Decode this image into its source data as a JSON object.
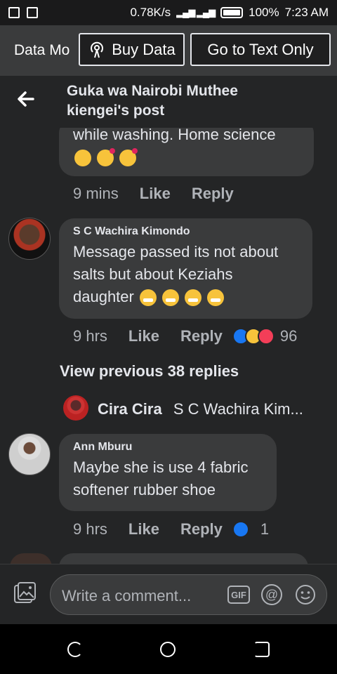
{
  "status_bar": {
    "speed": "0.78K/s",
    "battery": "100%",
    "time": "7:23 AM"
  },
  "data_bar": {
    "mode_label": "Data Mo",
    "buy_data_label": "Buy Data",
    "text_only_label": "Go to Text Only"
  },
  "header": {
    "title_line1": "Guka wa Nairobi Muthee",
    "title_line2": "kiengei's post"
  },
  "comments": [
    {
      "text": "while washing.  Home science",
      "time": "9 mins",
      "like": "Like",
      "reply": "Reply"
    },
    {
      "author": "S C Wachira Kimondo",
      "text_line1": "Message passed its not about",
      "text_line2": "salts but about Keziahs",
      "text_line3": "daughter",
      "time": "9 hrs",
      "like": "Like",
      "reply": "Reply",
      "reaction_count": "96"
    },
    {
      "author": "Ann Mburu",
      "text_line1": "Maybe she is use 4 fabric",
      "text_line2": "softener rubber shoe",
      "time": "9 hrs",
      "like": "Like",
      "reply": "Reply",
      "reaction_count": "1"
    }
  ],
  "view_previous": "View previous 38 replies",
  "reply_preview": {
    "name": "Cira Cira",
    "text": "S C Wachira Kim..."
  },
  "composer": {
    "placeholder": "Write a comment...",
    "gif_label": "GIF",
    "at_label": "@"
  },
  "icons": {
    "back": "back-arrow-icon",
    "photo": "photo-icon",
    "gif": "gif-icon",
    "mention": "at-icon",
    "emoji": "emoji-icon"
  },
  "colors": {
    "background": "#242526",
    "bubble": "#3a3b3c",
    "like_blue": "#1877f2",
    "love_red": "#f33e58",
    "haha_yellow": "#f7c33b"
  }
}
